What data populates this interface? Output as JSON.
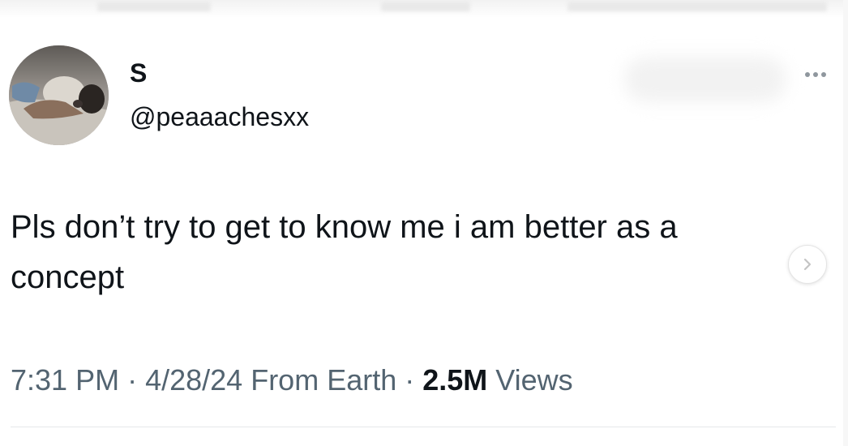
{
  "author": {
    "display_name": "S",
    "handle": "@peaaachesxx"
  },
  "tweet": {
    "text": "Pls don’t try to get to know me i am better as a concept"
  },
  "meta": {
    "time": "7:31 PM",
    "separator1": " · ",
    "date": "4/28/24",
    "location": " From Earth",
    "separator2": " · ",
    "views_count": "2.5M",
    "views_label": " Views"
  },
  "icons": {
    "more": "more-horizontal-icon",
    "next": "chevron-right-icon"
  },
  "colors": {
    "text_primary": "#0f1419",
    "text_secondary": "#536471",
    "divider": "#e6e8ea"
  }
}
